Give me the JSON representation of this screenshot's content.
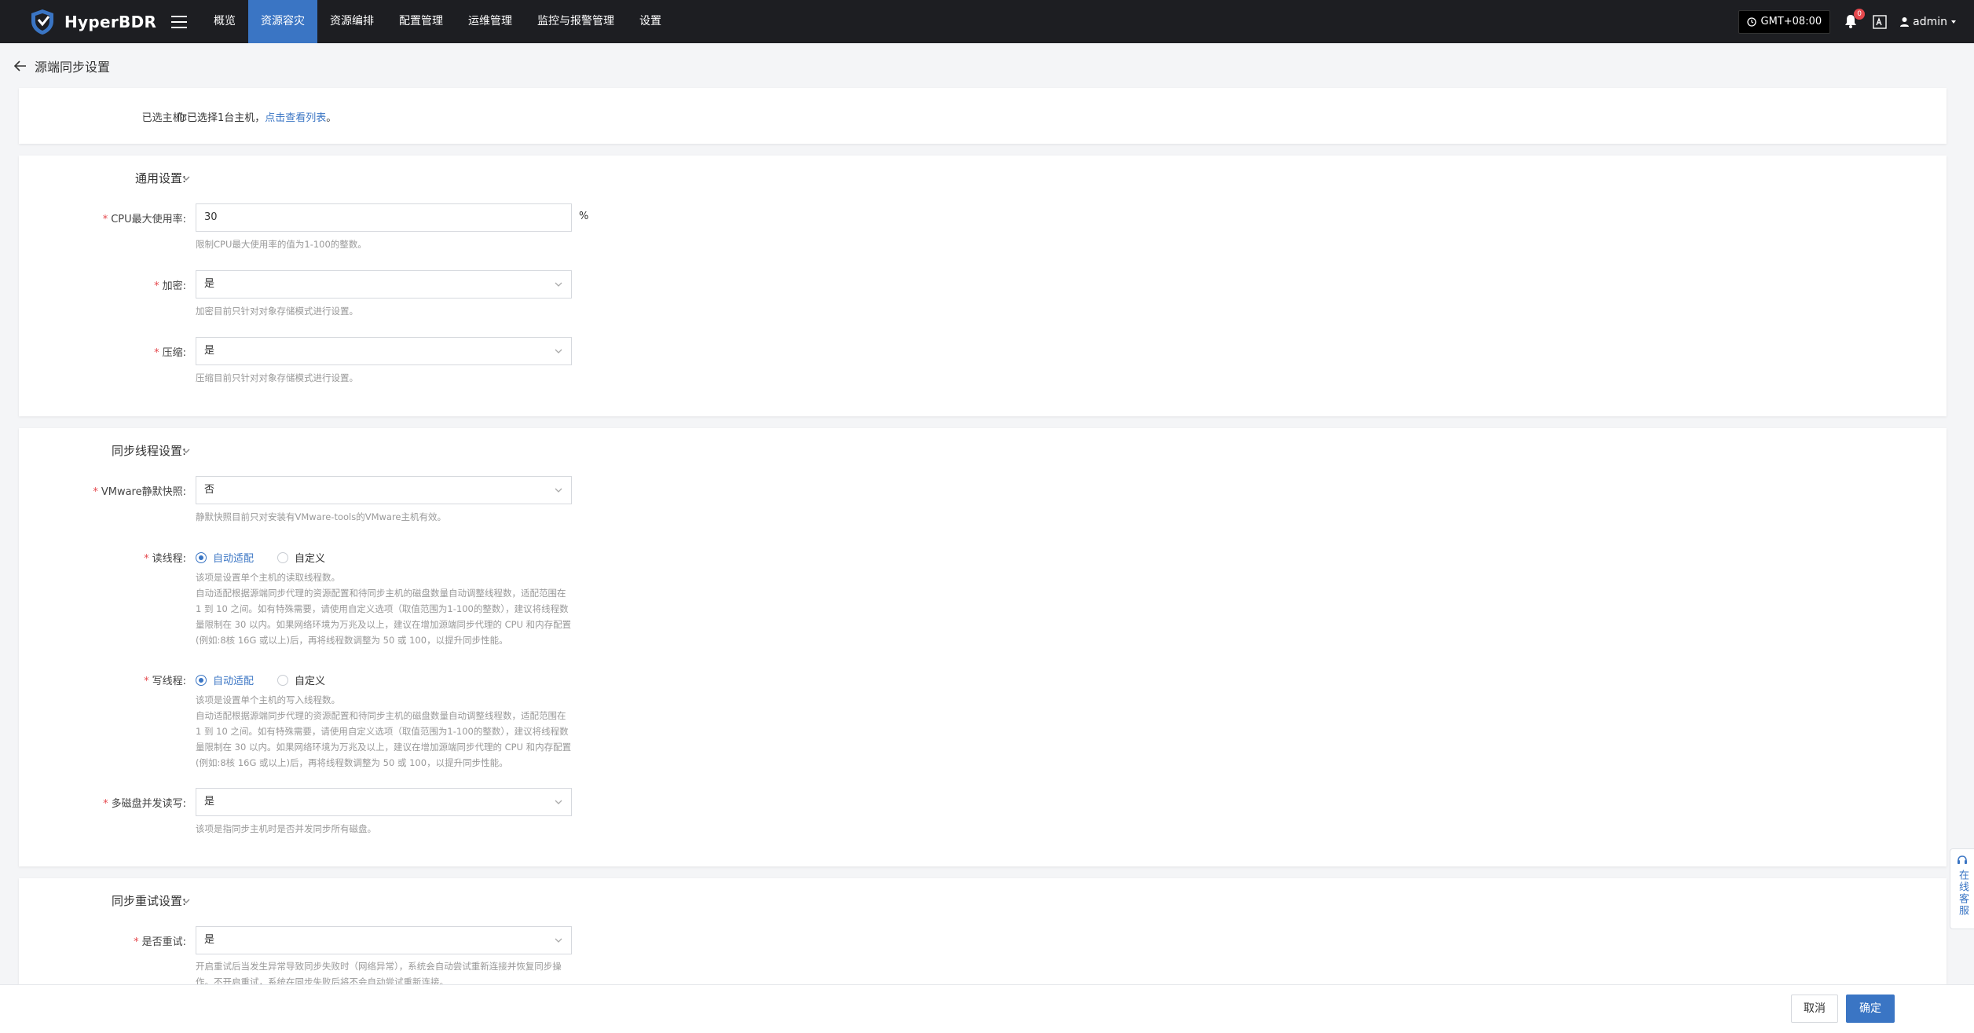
{
  "app": {
    "name": "HyperBDR",
    "nav": [
      {
        "label": "概览",
        "active": false
      },
      {
        "label": "资源容灾",
        "active": true
      },
      {
        "label": "资源编排",
        "active": false
      },
      {
        "label": "配置管理",
        "active": false
      },
      {
        "label": "运维管理",
        "active": false
      },
      {
        "label": "监控与报警管理",
        "active": false
      },
      {
        "label": "设置",
        "active": false
      }
    ],
    "timezone": "GMT+08:00",
    "notifications_count": "0",
    "user": "admin",
    "accent_color": "#3a75c4"
  },
  "page": {
    "title": "源端同步设置"
  },
  "selected_hosts": {
    "label": "已选主机:",
    "text": "你已选择1台主机，",
    "link": "点击查看列表",
    "tail": "。"
  },
  "general": {
    "title": "通用设置:",
    "cpu": {
      "label": "CPU最大使用率:",
      "value": "30",
      "unit": "%",
      "hint": "限制CPU最大使用率的值为1-100的整数。"
    },
    "encrypt": {
      "label": "加密:",
      "value": "是",
      "hint": "加密目前只针对对象存储模式进行设置。"
    },
    "compress": {
      "label": "压缩:",
      "value": "是",
      "hint": "压缩目前只针对对象存储模式进行设置。"
    }
  },
  "threads": {
    "title": "同步线程设置:",
    "vmware": {
      "label": "VMware静默快照:",
      "value": "否",
      "hint": "静默快照目前只对安装有VMware-tools的VMware主机有效。"
    },
    "read": {
      "label": "读线程:",
      "opt_auto": "自动适配",
      "opt_custom": "自定义",
      "hint1": "该项是设置单个主机的读取线程数。",
      "hint2": "自动适配根据源端同步代理的资源配置和待同步主机的磁盘数量自动调整线程数，适配范围在 1 到 10 之间。如有特殊需要，请使用自定义选项（取值范围为1-100的整数），建议将线程数量限制在 30 以内。如果网络环境为万兆及以上，建议在增加源端同步代理的 CPU 和内存配置(例如:8核 16G 或以上)后，再将线程数调整为 50 或 100，以提升同步性能。"
    },
    "write": {
      "label": "写线程:",
      "opt_auto": "自动适配",
      "opt_custom": "自定义",
      "hint1": "该项是设置单个主机的写入线程数。",
      "hint2": "自动适配根据源端同步代理的资源配置和待同步主机的磁盘数量自动调整线程数，适配范围在 1 到 10 之间。如有特殊需要，请使用自定义选项（取值范围为1-100的整数），建议将线程数量限制在 30 以内。如果网络环境为万兆及以上，建议在增加源端同步代理的 CPU 和内存配置(例如:8核 16G 或以上)后，再将线程数调整为 50 或 100，以提升同步性能。"
    },
    "multidisk": {
      "label": "多磁盘并发读写:",
      "value": "是",
      "hint": "该项是指同步主机时是否并发同步所有磁盘。"
    }
  },
  "retry": {
    "title": "同步重试设置:",
    "enable": {
      "label": "是否重试:",
      "value": "是",
      "hint": "开启重试后当发生异常导致同步失败时（网络异常），系统会自动尝试重新连接并恢复同步操作。不开启重试，系统在同步失败后将不会自动尝试重新连接。"
    }
  },
  "footer": {
    "cancel": "取消",
    "ok": "确定"
  },
  "service_tab": {
    "label": "在线客服"
  }
}
